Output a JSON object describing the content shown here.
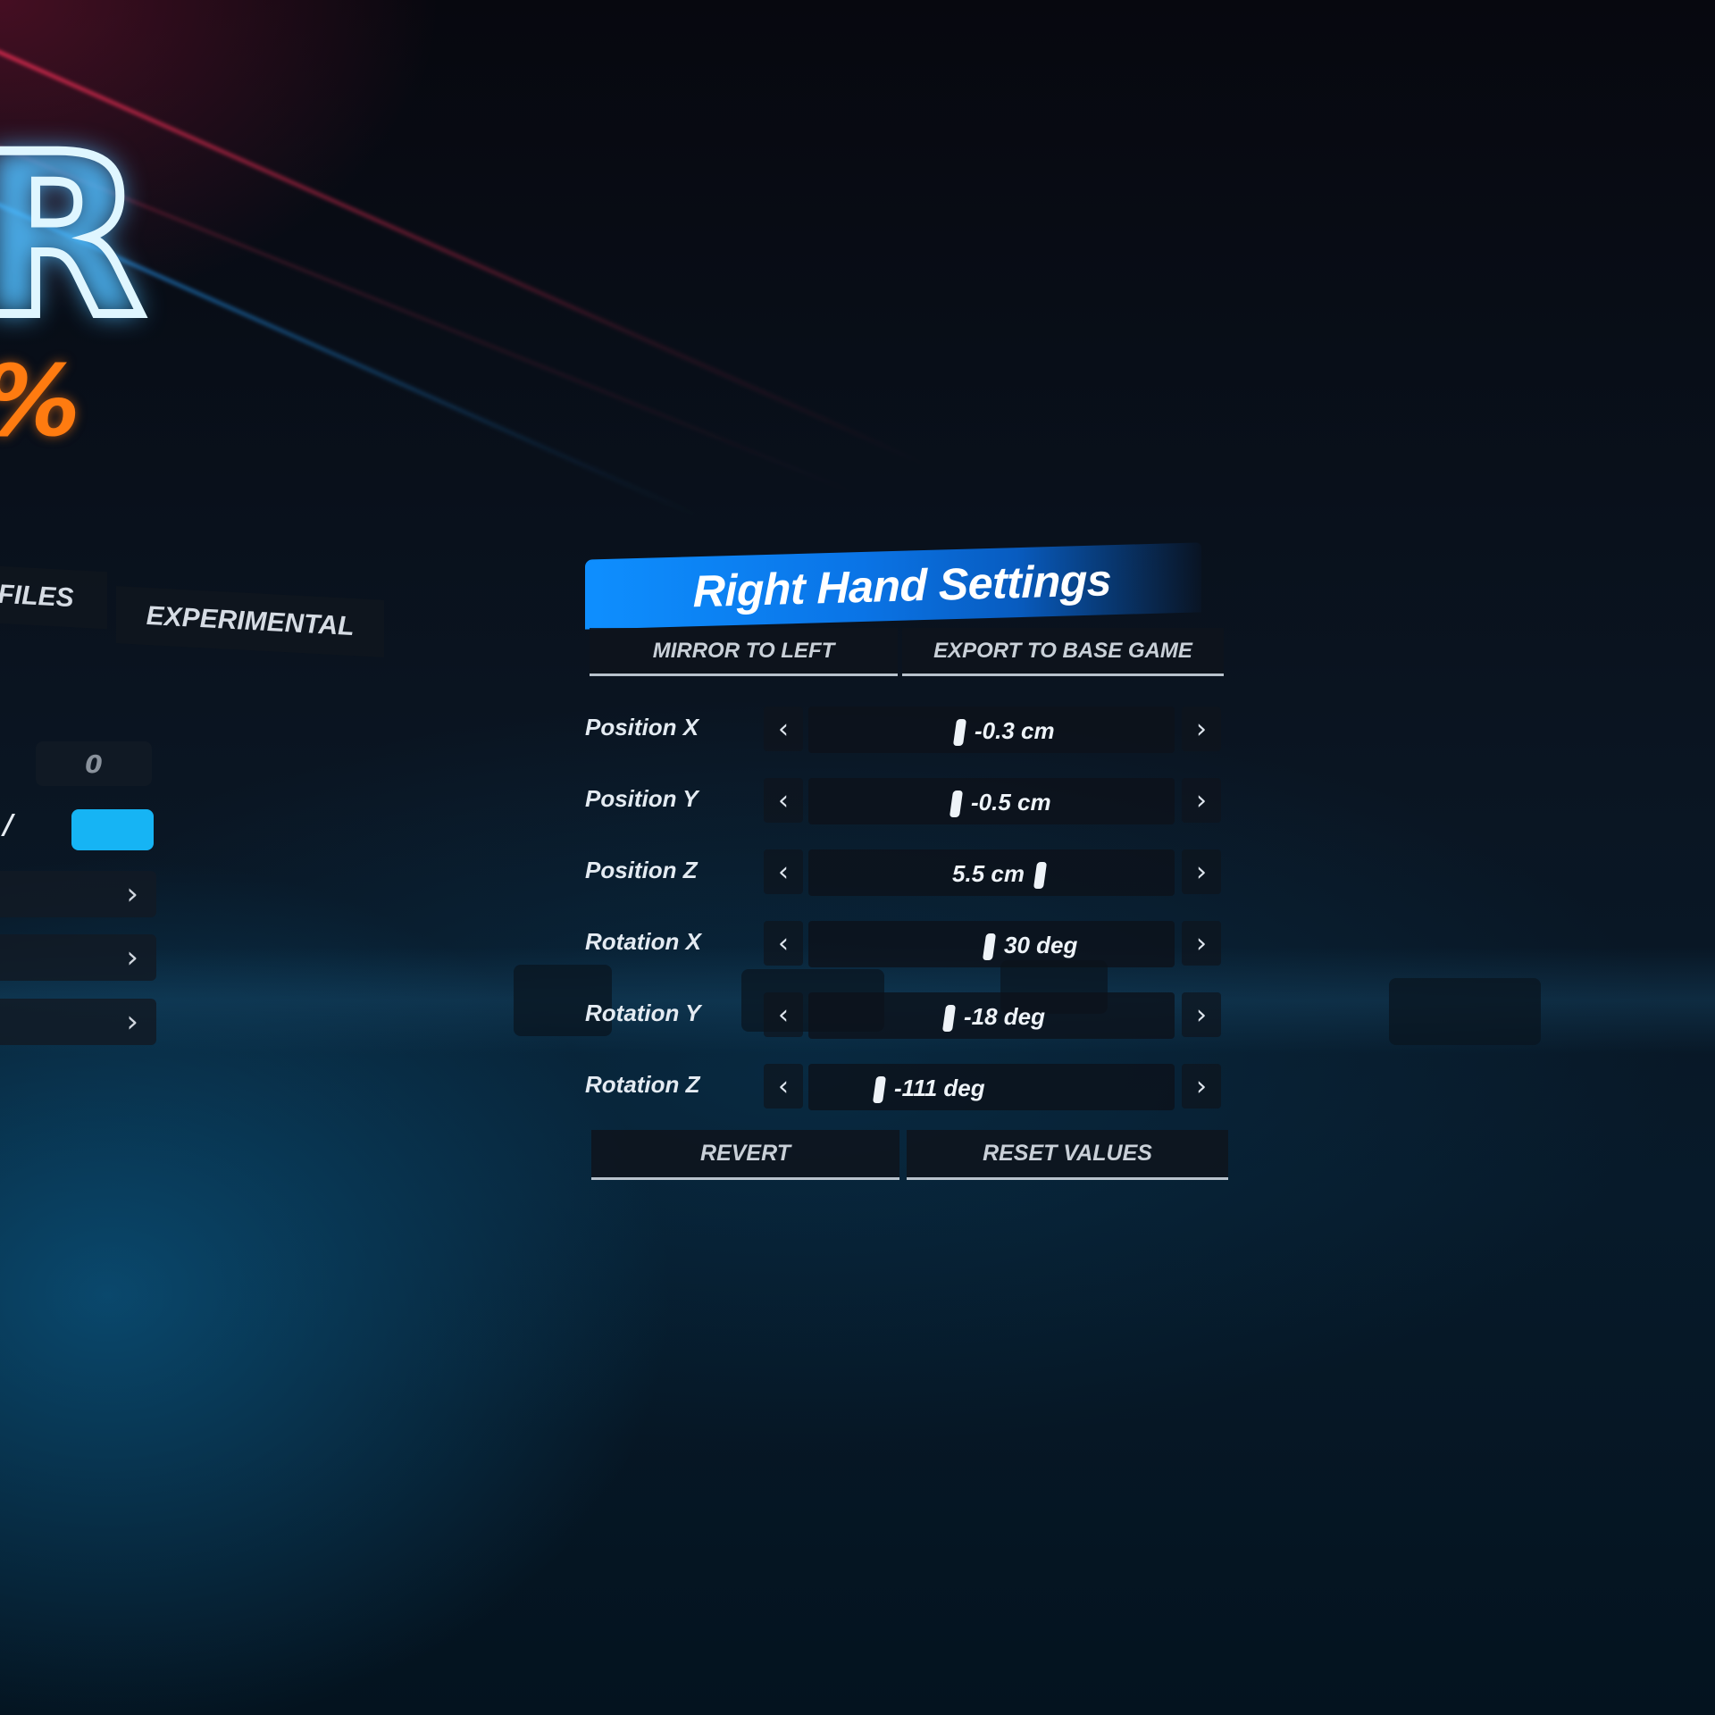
{
  "background_menu": {
    "logo_letter": "R",
    "percent_glyph": "%",
    "tabs": [
      {
        "label": "FILES"
      },
      {
        "label": "EXPERIMENTAL"
      }
    ],
    "value_box": "0",
    "slash_text": "/"
  },
  "panel": {
    "title": "Right Hand Settings",
    "top_buttons": {
      "mirror": "MIRROR TO LEFT",
      "export": "EXPORT TO BASE GAME"
    },
    "settings": [
      {
        "label": "Position X",
        "value": "-0.3 cm",
        "handle_fraction": 0.4
      },
      {
        "label": "Position Y",
        "value": "-0.5 cm",
        "handle_fraction": 0.39
      },
      {
        "label": "Position Z",
        "value": "5.5 cm",
        "handle_fraction": 0.62
      },
      {
        "label": "Rotation X",
        "value": "30 deg",
        "handle_fraction": 0.48
      },
      {
        "label": "Rotation Y",
        "value": "-18 deg",
        "handle_fraction": 0.37
      },
      {
        "label": "Rotation Z",
        "value": "-111 deg",
        "handle_fraction": 0.18
      }
    ],
    "bottom_buttons": {
      "revert": "REVERT",
      "reset": "RESET VALUES"
    },
    "arrows": {
      "left": "‹",
      "right": "›"
    }
  },
  "colors": {
    "title_bar": "#0e8fff",
    "accent_toggle": "#16b4f4",
    "percent": "#ff7b10"
  }
}
